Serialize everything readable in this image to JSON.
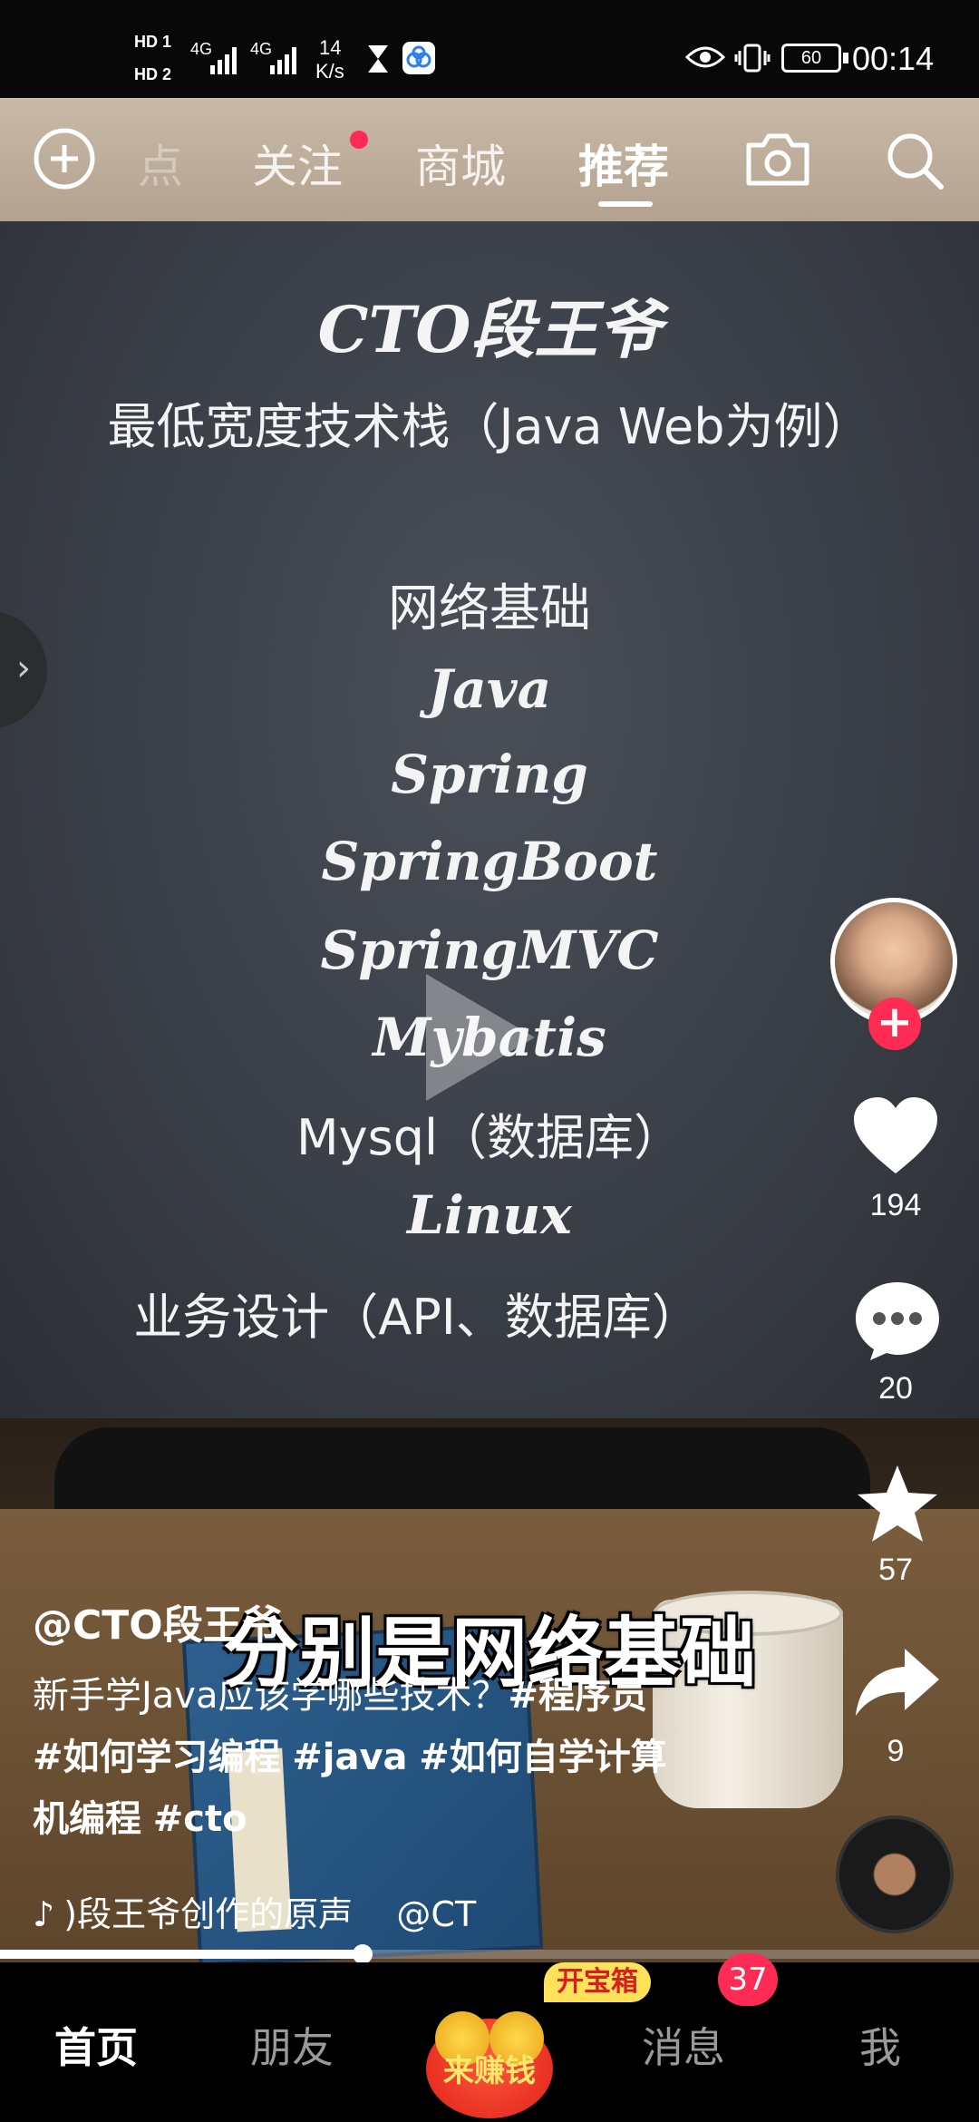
{
  "status_bar": {
    "hd1": "HD 1",
    "hd2": "HD 2",
    "net1": "4G",
    "net2": "4G",
    "speed_value": "14",
    "speed_unit": "K/s",
    "battery": "60",
    "time": "00:14"
  },
  "top_nav": {
    "tabs": [
      {
        "label": "点"
      },
      {
        "label": "关注"
      },
      {
        "label": "商城"
      },
      {
        "label": "推荐"
      }
    ]
  },
  "video": {
    "board_title": "CTO段王爷",
    "board_subtitle": "最低宽度技术栈（Java Web为例）",
    "items": [
      "网络基础",
      "Java",
      "Spring",
      "SpringBoot",
      "SpringMVC",
      "Mybatis",
      "Mysql（数据库）",
      "Linux",
      "业务设计（API、数据库）"
    ],
    "subtitle": "分别是网络基础"
  },
  "rail": {
    "likes": "194",
    "comments": "20",
    "favorites": "57",
    "shares": "9"
  },
  "caption": {
    "author": "@CTO段王爷",
    "desc_plain": "新手学Java应该学哪些技术？",
    "tag1": "#程序员",
    "tag2": "#如何学习编程",
    "tag3": "#java",
    "tag4": "#如何自学计算机编程",
    "tag5": "#cto",
    "music": ")段王爷创作的原声    @CT"
  },
  "progress": 0.37,
  "bottom_nav": {
    "home": "首页",
    "friends": "朋友",
    "earn": "来赚钱",
    "treasure": "开宝箱",
    "messages": "消息",
    "messages_badge": "37",
    "me": "我"
  },
  "colors": {
    "accent": "#fe2c55",
    "treasure_bg": "#ffe15a"
  }
}
